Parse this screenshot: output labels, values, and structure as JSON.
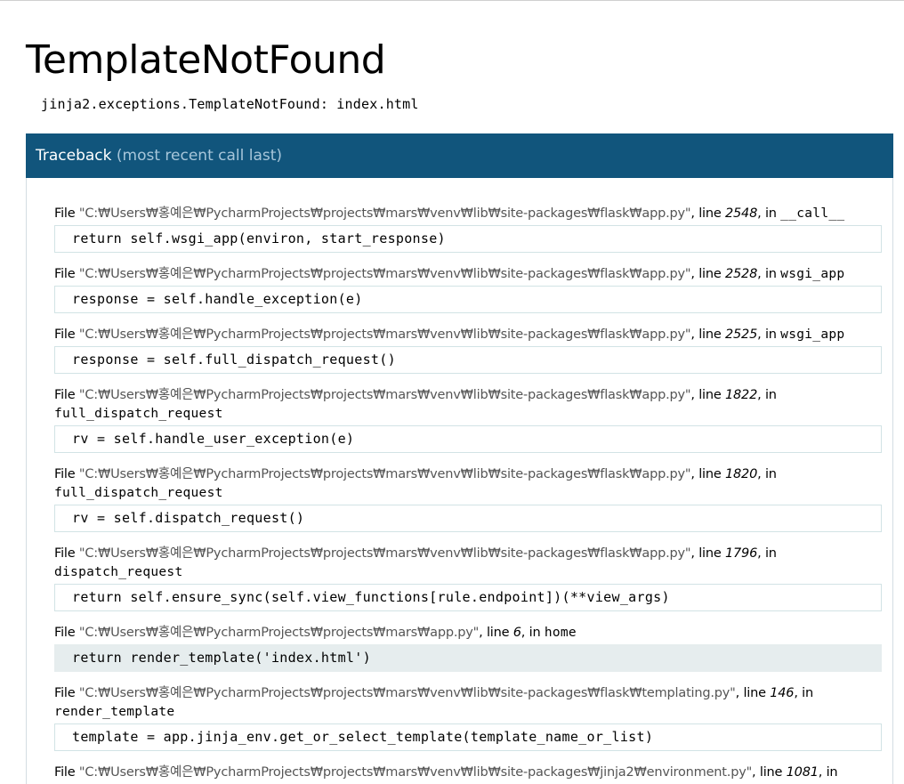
{
  "error": {
    "title": "TemplateNotFound",
    "message": "jinja2.exceptions.TemplateNotFound: index.html"
  },
  "traceback": {
    "heading": "Traceback",
    "subheading": "(most recent call last)",
    "file_word": "File",
    "line_word": "line",
    "in_word": "in",
    "frames": [
      {
        "path": "\"C:₩Users₩홍예은₩PycharmProjects₩projects₩mars₩venv₩lib₩site-packages₩flask₩app.py\"",
        "line": "2548",
        "func": "__call__",
        "source": "return self.wsgi_app(environ, start_response)",
        "current": false
      },
      {
        "path": "\"C:₩Users₩홍예은₩PycharmProjects₩projects₩mars₩venv₩lib₩site-packages₩flask₩app.py\"",
        "line": "2528",
        "func": "wsgi_app",
        "source": "response = self.handle_exception(e)",
        "current": false
      },
      {
        "path": "\"C:₩Users₩홍예은₩PycharmProjects₩projects₩mars₩venv₩lib₩site-packages₩flask₩app.py\"",
        "line": "2525",
        "func": "wsgi_app",
        "source": "response = self.full_dispatch_request()",
        "current": false
      },
      {
        "path": "\"C:₩Users₩홍예은₩PycharmProjects₩projects₩mars₩venv₩lib₩site-packages₩flask₩app.py\"",
        "line": "1822",
        "func": "full_dispatch_request",
        "source": "rv = self.handle_user_exception(e)",
        "current": false,
        "wrap": true
      },
      {
        "path": "\"C:₩Users₩홍예은₩PycharmProjects₩projects₩mars₩venv₩lib₩site-packages₩flask₩app.py\"",
        "line": "1820",
        "func": "full_dispatch_request",
        "source": "rv = self.dispatch_request()",
        "current": false,
        "wrap": true
      },
      {
        "path": "\"C:₩Users₩홍예은₩PycharmProjects₩projects₩mars₩venv₩lib₩site-packages₩flask₩app.py\"",
        "line": "1796",
        "func": "dispatch_request",
        "source": "return self.ensure_sync(self.view_functions[rule.endpoint])(**view_args)",
        "current": false,
        "wrap": true
      },
      {
        "path": "\"C:₩Users₩홍예은₩PycharmProjects₩projects₩mars₩app.py\"",
        "line": "6",
        "func": "home",
        "source": "return render_template('index.html')",
        "current": true
      },
      {
        "path": "\"C:₩Users₩홍예은₩PycharmProjects₩projects₩mars₩venv₩lib₩site-packages₩flask₩templating.py\"",
        "line": "146",
        "func": "render_template",
        "source": "template = app.jinja_env.get_or_select_template(template_name_or_list)",
        "current": false,
        "wrap": true
      },
      {
        "path": "\"C:₩Users₩홍예은₩PycharmProjects₩projects₩mars₩venv₩lib₩site-packages₩jinja2₩environment.py\"",
        "line": "1081",
        "func": "",
        "source": "",
        "current": false,
        "wrap": true
      }
    ]
  }
}
